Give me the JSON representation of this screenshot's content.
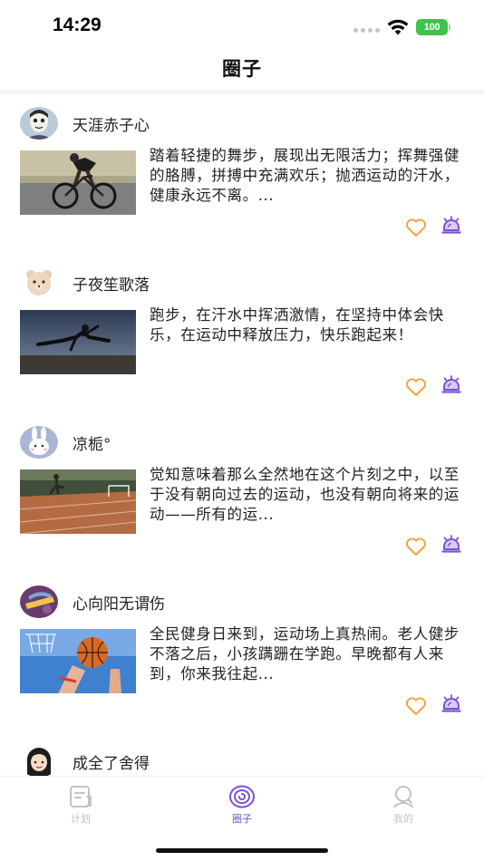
{
  "status_bar": {
    "time": "14:29",
    "battery": "100",
    "battery_color": "#3cc44a"
  },
  "nav": {
    "title": "圈子"
  },
  "accent_color": "#7b52d0",
  "like_color": "#f0a63c",
  "posts": [
    {
      "username": "天涯赤子心",
      "text": "踏着轻捷的舞步，展现出无限活力；挥舞强健的胳膊，拼搏中充满欢乐；抛洒运动的汗水，健康永远不离。...",
      "avatar_icon": "cartoon-face-avatar",
      "image": "cyclist-photo"
    },
    {
      "username": "子夜笙歌落",
      "text": "跑步，在汗水中挥洒激情，在坚持中体会快乐，在运动中释放压力，快乐跑起来！",
      "avatar_icon": "plush-bear-avatar",
      "image": "leaping-runner-photo"
    },
    {
      "username": "凉栀°",
      "text": "觉知意味着那么全然地在这个片刻之中，以至于没有朝向过去的运动，也没有朝向将来的运动——所有的运...",
      "avatar_icon": "bunny-avatar",
      "image": "track-runner-photo"
    },
    {
      "username": "心向阳无谓伤",
      "text": "全民健身日来到，运动场上真热闹。老人健步不落之后，小孩蹒跚在学跑。早晚都有人来到，你来我往起...",
      "avatar_icon": "purple-hat-avatar",
      "image": "basketball-photo"
    },
    {
      "username": "成全了舍得",
      "text": "",
      "avatar_icon": "girl-avatar",
      "image": ""
    }
  ],
  "tabs": [
    {
      "label": "计划",
      "icon": "plan-icon",
      "active": false
    },
    {
      "label": "圈子",
      "icon": "circle-icon",
      "active": true
    },
    {
      "label": "我的",
      "icon": "profile-icon",
      "active": false
    }
  ]
}
